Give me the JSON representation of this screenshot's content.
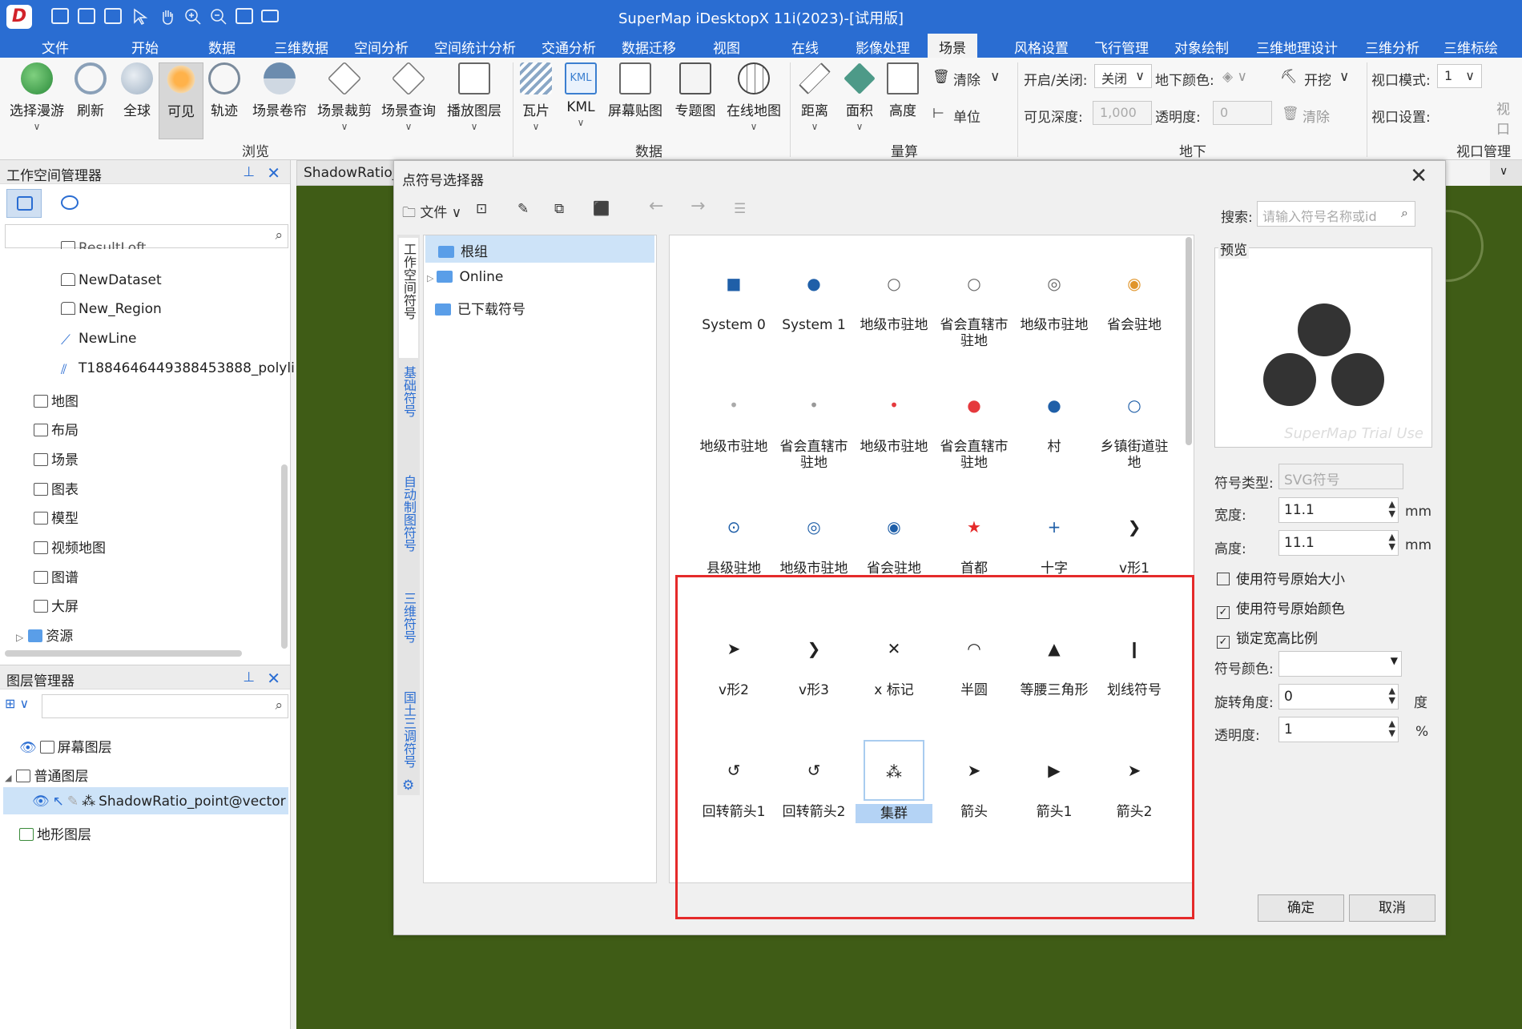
{
  "app": {
    "title": "SuperMap iDesktopX 11i(2023)-[试用版]",
    "logo": "D",
    "accent": "#2a6dd2"
  },
  "menu": [
    "文件",
    "开始",
    "数据",
    "三维数据",
    "空间分析",
    "空间统计分析",
    "交通分析",
    "数据迁移",
    "视图",
    "在线",
    "影像处理",
    "场景",
    "风格设置",
    "飞行管理",
    "对象绘制",
    "三维地理设计",
    "三维分析",
    "三维标绘"
  ],
  "ribbon": {
    "buttons": [
      "选择漫游",
      "刷新",
      "全球",
      "可见",
      "轨迹",
      "场景卷帘",
      "场景裁剪",
      "场景查询",
      "播放图层",
      "瓦片",
      "KML",
      "屏幕贴图",
      "专题图",
      "在线地图",
      "距离",
      "面积",
      "高度"
    ],
    "groups": [
      "浏览",
      "数据",
      "量算",
      "地下",
      "视口管理"
    ],
    "clear": "清除",
    "unit": "单位",
    "toggle_label": "开启/关闭:",
    "toggle_value": "关闭",
    "underground_color": "地下颜色:",
    "dig": "开挖",
    "viewport_mode": "视口模式:",
    "viewport_mode_value": "1",
    "visible_depth": "可见深度:",
    "visible_depth_value": "1,000",
    "opacity": "透明度:",
    "opacity_value": "0",
    "clear2": "清除",
    "viewport_settings": "视口设置:",
    "right_cut": "视口"
  },
  "workspace": {
    "title": "工作空间管理器",
    "items": [
      "ResultLoft",
      "NewDataset",
      "New_Region",
      "NewLine",
      "T1884646449388453888_polyli",
      "地图",
      "布局",
      "场景",
      "图表",
      "模型",
      "视频地图",
      "图谱",
      "大屏",
      "资源"
    ]
  },
  "layers": {
    "title": "图层管理器",
    "items": [
      "屏幕图层",
      "普通图层",
      "ShadowRatio_point@vector",
      "地形图层"
    ]
  },
  "scene_tab": "ShadowRatio_",
  "dialog": {
    "title": "点符号选择器",
    "file_menu": "文件",
    "search_label": "搜索:",
    "search_placeholder": "请输入符号名称或id",
    "vtabs": [
      "工作空间符号",
      "基础符号",
      "自动制图符号",
      "三维符号",
      "国土三调符号"
    ],
    "groups": [
      "根组",
      "Online",
      "已下载符号"
    ],
    "symbols": [
      {
        "glyph": "■",
        "label": "System 0",
        "color": "#1f5fa8"
      },
      {
        "glyph": "●",
        "label": "System 1",
        "color": "#1f5fa8"
      },
      {
        "glyph": "○",
        "label": "地级市驻地",
        "color": "#666"
      },
      {
        "glyph": "○",
        "label": "省会直辖市驻地",
        "color": "#666"
      },
      {
        "glyph": "◎",
        "label": "地级市驻地",
        "color": "#666"
      },
      {
        "glyph": "◉",
        "label": "省会驻地",
        "color": "#e0952b"
      },
      {
        "glyph": "•",
        "label": "地级市驻地",
        "color": "#aaa"
      },
      {
        "glyph": "•",
        "label": "省会直辖市驻地",
        "color": "#999"
      },
      {
        "glyph": "•",
        "label": "地级市驻地",
        "color": "#e5393d"
      },
      {
        "glyph": "●",
        "label": "省会直辖市驻地",
        "color": "#e5393d"
      },
      {
        "glyph": "●",
        "label": "村",
        "color": "#1f5fa8"
      },
      {
        "glyph": "○",
        "label": "乡镇街道驻地",
        "color": "#1f5fa8"
      },
      {
        "glyph": "⊙",
        "label": "县级驻地",
        "color": "#1f5fa8"
      },
      {
        "glyph": "◎",
        "label": "地级市驻地",
        "color": "#1f5fa8"
      },
      {
        "glyph": "◉",
        "label": "省会驻地",
        "color": "#1f5fa8"
      },
      {
        "glyph": "★",
        "label": "首都",
        "color": "#e52a2a"
      },
      {
        "glyph": "+",
        "label": "十字",
        "color": "#1f5fa8"
      },
      {
        "glyph": "❯",
        "label": "v形1",
        "color": "#222"
      },
      {
        "glyph": "➤",
        "label": "v形2",
        "color": "#222"
      },
      {
        "glyph": "❯",
        "label": "v形3",
        "color": "#222"
      },
      {
        "glyph": "✕",
        "label": "x 标记",
        "color": "#222"
      },
      {
        "glyph": "◠",
        "label": "半圆",
        "color": "#222"
      },
      {
        "glyph": "▲",
        "label": "等腰三角形",
        "color": "#222"
      },
      {
        "glyph": "❙",
        "label": "划线符号",
        "color": "#222"
      },
      {
        "glyph": "↺",
        "label": "回转箭头1",
        "color": "#222"
      },
      {
        "glyph": "↺",
        "label": "回转箭头2",
        "color": "#222"
      },
      {
        "glyph": "⁂",
        "label": "集群",
        "color": "#222"
      },
      {
        "glyph": "➤",
        "label": "箭头",
        "color": "#222"
      },
      {
        "glyph": "▶",
        "label": "箭头1",
        "color": "#222"
      },
      {
        "glyph": "➤",
        "label": "箭头2",
        "color": "#222"
      },
      {
        "glyph": "›",
        "label": "",
        "color": "#222"
      },
      {
        "glyph": "➤",
        "label": "",
        "color": "#222"
      },
      {
        "glyph": "➤",
        "label": "",
        "color": "#222"
      },
      {
        "glyph": "➤",
        "label": "",
        "color": "#222"
      },
      {
        "glyph": "›",
        "label": "",
        "color": "#222"
      },
      {
        "glyph": "➤",
        "label": "",
        "color": "#222"
      }
    ],
    "selected_symbol": "集群",
    "preview_label": "预览",
    "symbol_type_label": "符号类型:",
    "symbol_type_value": "SVG符号",
    "width_label": "宽度:",
    "width_value": "11.1",
    "height_label": "高度:",
    "height_value": "11.1",
    "mm": "mm",
    "use_original_size": "使用符号原始大小",
    "use_original_color": "使用符号原始颜色",
    "lock_ratio": "锁定宽高比例",
    "symbol_color_label": "符号颜色:",
    "rotation_label": "旋转角度:",
    "rotation_value": "0",
    "degree": "度",
    "opacity_label": "透明度:",
    "opacity_value": "1",
    "percent": "%",
    "ok": "确定",
    "cancel": "取消",
    "watermark": "SuperMap Trial Use"
  }
}
